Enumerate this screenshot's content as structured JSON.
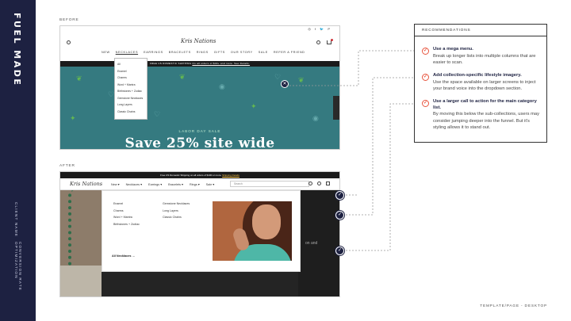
{
  "sidebar": {
    "brand": "FUEL MADE",
    "client_label": "CLIENT NAME",
    "project_label": "CONVERSION RATE OPTIMIZATION"
  },
  "before": {
    "label": "BEFORE",
    "logo": "Kris Nations",
    "social_icons": "◎ f 🐦 P",
    "nav": [
      "NEW",
      "NECKLACES",
      "EARRINGS",
      "BRACELETS",
      "RINGS",
      "GIFTS",
      "OUR STORY",
      "SALE",
      "REFER A FRIEND"
    ],
    "shipping_text": "FREE US DOMESTIC SHIPPING",
    "shipping_link": "On all orders of $40+ and more. See Details.",
    "dropdown": [
      "All",
      "Enamel",
      "Charms",
      "Word + Mantra",
      "Birthstones + Zodiac",
      "Gemstone Necklaces",
      "Long Layers",
      "Classic Chains"
    ],
    "hero_subtitle": "LABOR DAY SALE",
    "hero_title": "Save 25% site wide",
    "close_icon": "close-icon"
  },
  "after": {
    "label": "AFTER",
    "logo": "Kris Nations",
    "topbar_text": "Free US Domestic Shipping on all orders of $100 or more.",
    "topbar_link": "Shipping Details",
    "nav": [
      "New ▾",
      "Necklaces ▾",
      "Earrings ▾",
      "Bracelets ▾",
      "Rings ▾",
      "Sale ▾"
    ],
    "search_placeholder": "Search",
    "mega_col1": [
      "Enamel",
      "Charms",
      "Word + Mantra",
      "Birthstones + Zodiac"
    ],
    "mega_col2": [
      "Gemstone Necklaces",
      "Long Layers",
      "Classic Chains"
    ],
    "all_link": "All Necklaces  →",
    "bg_text": "on and"
  },
  "recommendations": {
    "header": "RECOMMENDATIONS",
    "items": [
      {
        "title": "Use a mega menu.",
        "body": "Break up longer lists into multiple columns that are easier to scan."
      },
      {
        "title": "Add collection-specific lifestyle imagery.",
        "body": "Use the space available on larger screens to inject your brand voice into the dropdown section."
      },
      {
        "title": "Use a larger call to action for the main category list.",
        "body": "By moving this below the sub-collections, users may consider jumping deeper into the funnel. But it's styling allows it to stand out."
      }
    ]
  },
  "footer": "TEMPLATE/PAGE - DESKTOP",
  "colors": {
    "navy": "#1d2141",
    "accent": "#e8553e",
    "hero_teal": "#357a80"
  }
}
